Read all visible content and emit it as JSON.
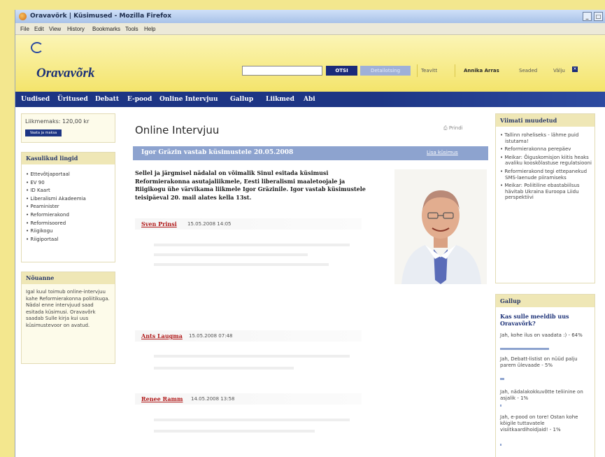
{
  "window": {
    "title": "Oravavõrk | Küsimused - Mozilla Firefox",
    "min": "_",
    "max": "□"
  },
  "menu": [
    "File",
    "Edit",
    "View",
    "History",
    "Bookmarks",
    "Tools",
    "Help"
  ],
  "header": {
    "logo": "Oravavõrk",
    "search_button": "OTSI",
    "search_ext": "Detailotsing",
    "feed": "Teavitt",
    "user": "Annika Arras",
    "settings": "Seaded",
    "logout": "Välju"
  },
  "nav": [
    "Uudised",
    "Üritused",
    "Debatt",
    "E-pood",
    "Online Intervjuu",
    "Gallup",
    "Liikmed",
    "Abi"
  ],
  "left": {
    "membership_label": "Liikmemaks: 120,00 kr",
    "membership_button": "Vaata ja maksa",
    "links_title": "Kasulikud lingid",
    "links": [
      "Ettevõtjaportaal",
      "EV 90",
      "ID Kaart",
      "Liberalismi Akadeemia",
      "Peaminister",
      "Reformierakond",
      "Reformisoored",
      "Riigikogu",
      "Riigiportaal"
    ],
    "advice_title": "Nõuanne",
    "advice_text": "Igal kuul toimub online-intervjuu kahe Reformierakonna poliitikuga. Nädal enne intervjuud saad esitada küsimusi. Oravavõrk saadab Sulle kirja kui uus küsimustevoor on avatud."
  },
  "main": {
    "title": "Online Intervjuu",
    "print": "Prindi",
    "interview_title": "Igor Gräzin vastab küsimustele 20.05.2008",
    "add_question": "Lisa küsimus",
    "intro": "Sellel ja järgmisel nädalal on võimalik Sinul esitada küsimusi Reformierakonna asutajaliikmele, Eesti liberalismi maaletoojale ja Riigikogu ühe värvikama liikmele Igor Gräzinile. Igor vastab küsimustele teisipäeval 20. mail alates kella 13st.",
    "questions": [
      {
        "author": "Sven Prinsi",
        "date": "15.05.2008 14:05"
      },
      {
        "author": "Ants Laugma",
        "date": "15.05.2008 07:48"
      },
      {
        "author": "Renee Ramm",
        "date": "14.05.2008 13:58"
      }
    ]
  },
  "right": {
    "recent_title": "Viimati muudetud",
    "recent": [
      "Tallinn roheliseks - lähme puid istutama!",
      "Reformierakonna perepäev",
      "Meikar: Õiguskomisjon kiitis heaks avaliku kooskõlastuse regulatsiooni",
      "Reformierakond tegi ettepanekud SMS-laenude piiramiseks",
      "Meikar: Poliitiline ebastabiilsus hävitab Ukraina Euroopa Liidu perspektiivi"
    ],
    "poll_title": "Gallup",
    "poll_question": "Kas sulle meeldib uus Oravavõrk?",
    "poll_options": [
      {
        "text": "Jah, kohe ilus on vaadata :) - 64%",
        "value": 64
      },
      {
        "text": "Jah, Debatt-listist on nüüd palju parem ülevaade - 5%",
        "value": 5
      },
      {
        "text": "Jah, nädalakokkuvõtte teliinine on asjalik - 1%",
        "value": 1
      },
      {
        "text": "Jah, e-pood on tore! Ostan kohe kõigile tuttavatele visiitkaardihoidjaid! - 1%",
        "value": 1
      }
    ]
  }
}
